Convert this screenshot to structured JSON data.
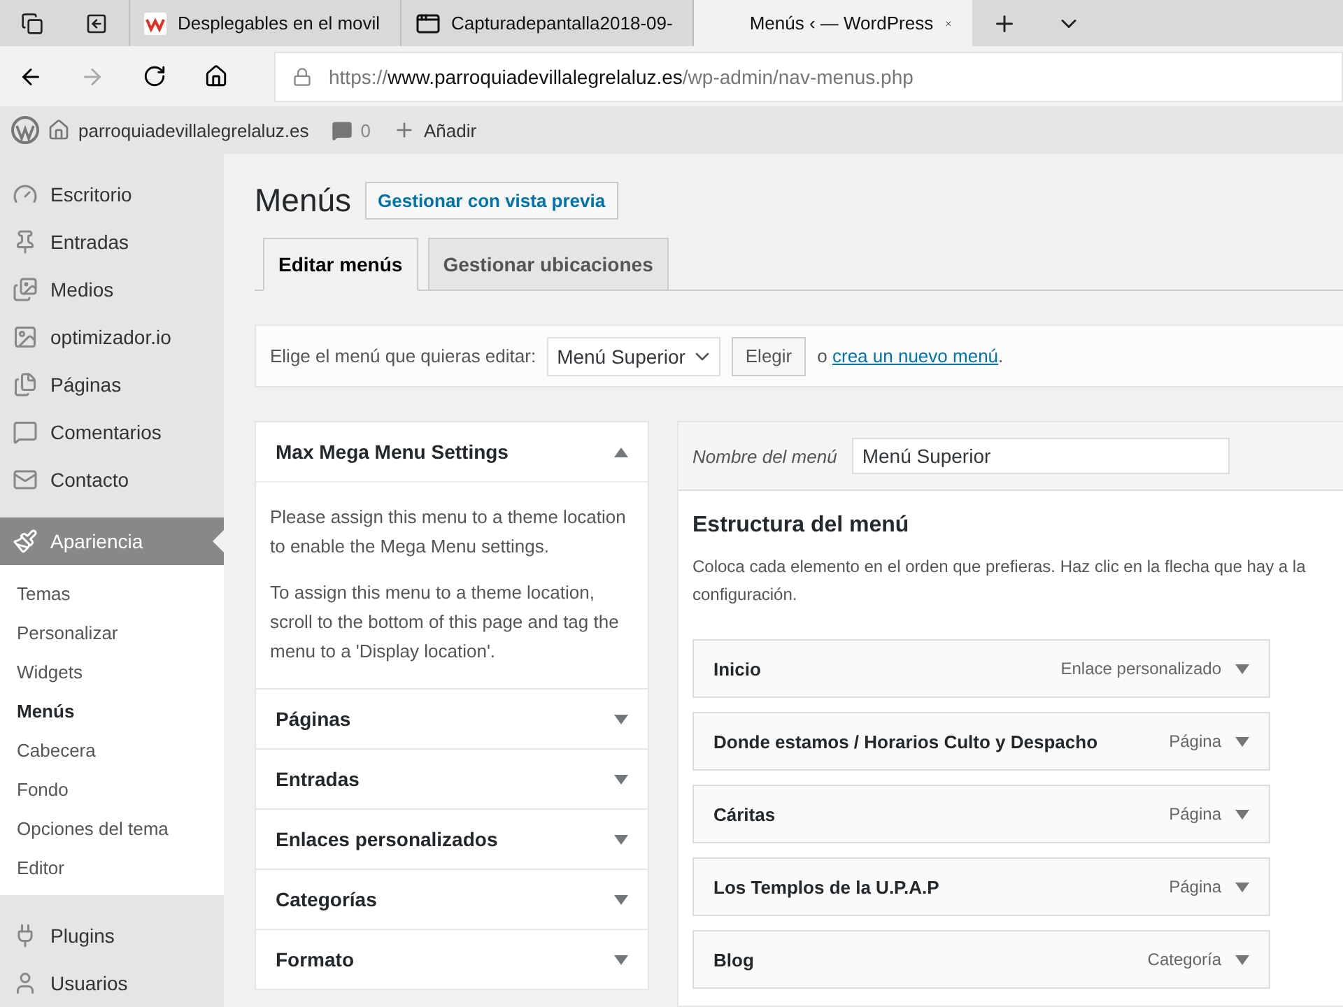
{
  "browser": {
    "tabs": [
      {
        "title": "Desplegables en el movil",
        "selected": false
      },
      {
        "title": "Capturadepantalla2018-09-",
        "selected": false
      },
      {
        "title": "Menús ‹ — WordPress",
        "selected": true
      }
    ],
    "address": {
      "scheme": "https://",
      "domain": "www.parroquiadevillalegrelaluz.es",
      "path": "/wp-admin/nav-menus.php"
    }
  },
  "admin_bar": {
    "site": "parroquiadevillalegrelaluz.es",
    "comments": "0",
    "add": "Añadir"
  },
  "sidebar": {
    "items": [
      {
        "label": "Escritorio",
        "selected": false
      },
      {
        "label": "Entradas",
        "selected": false
      },
      {
        "label": "Medios",
        "selected": false
      },
      {
        "label": "optimizador.io",
        "selected": false
      },
      {
        "label": "Páginas",
        "selected": false
      },
      {
        "label": "Comentarios",
        "selected": false
      },
      {
        "label": "Contacto",
        "selected": false
      },
      {
        "label": "Apariencia",
        "selected": true,
        "children": [
          {
            "label": "Temas",
            "selected": false
          },
          {
            "label": "Personalizar",
            "selected": false
          },
          {
            "label": "Widgets",
            "selected": false
          },
          {
            "label": "Menús",
            "selected": true
          },
          {
            "label": "Cabecera",
            "selected": false
          },
          {
            "label": "Fondo",
            "selected": false
          },
          {
            "label": "Opciones del tema",
            "selected": false
          },
          {
            "label": "Editor",
            "selected": false
          }
        ]
      },
      {
        "label": "Plugins",
        "selected": false
      },
      {
        "label": "Usuarios",
        "selected": false
      }
    ]
  },
  "page": {
    "title": "Menús",
    "preview_button": "Gestionar con vista previa",
    "tabs": [
      {
        "label": "Editar menús",
        "selected": true
      },
      {
        "label": "Gestionar ubicaciones",
        "selected": false
      }
    ],
    "select_bar": {
      "label": "Elige el menú que quieras editar:",
      "value": "Menú Superior",
      "button": "Elegir",
      "or": "o",
      "link": "crea un nuevo menú",
      "end": "."
    },
    "panels": [
      {
        "title": "Max Mega Menu Settings",
        "expanded": true,
        "paragraphs": [
          "Please assign this menu to a theme location to enable the Mega Menu settings.",
          "To assign this menu to a theme location, scroll to the bottom of this page and tag the menu to a 'Display location'."
        ]
      },
      {
        "title": "Páginas",
        "expanded": false
      },
      {
        "title": "Entradas",
        "expanded": false
      },
      {
        "title": "Enlaces personalizados",
        "expanded": false
      },
      {
        "title": "Categorías",
        "expanded": false
      },
      {
        "title": "Formato",
        "expanded": false
      }
    ],
    "editor": {
      "name_label": "Nombre del menú",
      "name_value": "Menú Superior",
      "heading": "Estructura del menú",
      "description_lines": [
        "Coloca cada elemento en el orden que prefieras. Haz clic en la flecha que hay a la",
        "configuración."
      ],
      "items": [
        {
          "title": "Inicio",
          "type": "Enlace personalizado"
        },
        {
          "title": "Donde estamos / Horarios Culto y Despacho",
          "type": "Página"
        },
        {
          "title": "Cáritas",
          "type": "Página"
        },
        {
          "title": "Los Templos de la U.P.A.P",
          "type": "Página"
        },
        {
          "title": "Blog",
          "type": "Categoría"
        }
      ]
    }
  }
}
